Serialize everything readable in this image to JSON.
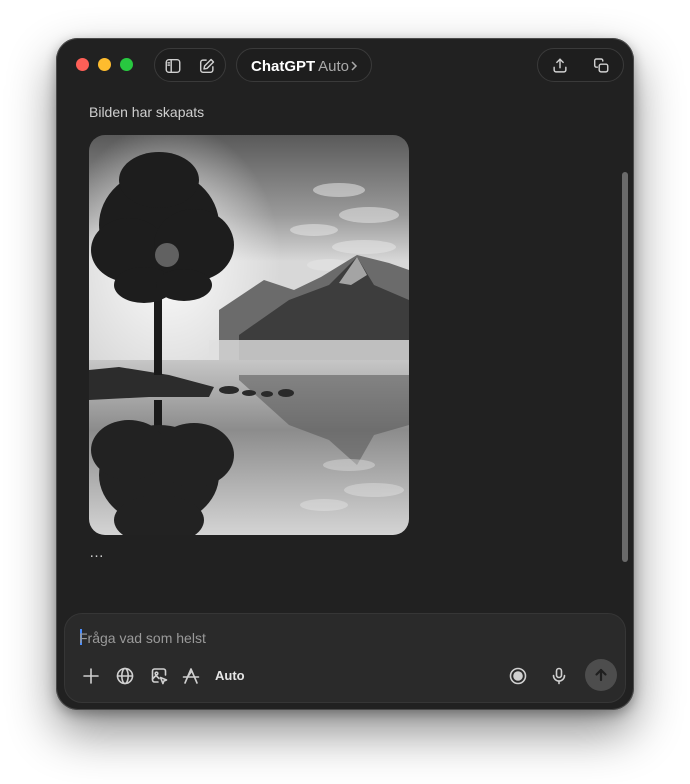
{
  "header": {
    "model_name": "ChatGPT",
    "model_mode": "Auto"
  },
  "conversation": {
    "status": "Bilden har skapats",
    "image": {
      "description_icon": "generated-image",
      "content": "black-and-white landscape"
    },
    "more_options": "…"
  },
  "composer": {
    "placeholder": "Fråga vad som helst",
    "mode_label": "Auto",
    "tools": [
      "plus-icon",
      "globe-icon",
      "image-edit-icon",
      "tools-icon"
    ],
    "right_tools": [
      "voice-mode-icon",
      "microphone-icon",
      "send-icon"
    ]
  },
  "colors": {
    "window_bg": "#212121",
    "composer_bg": "#2a2a2a",
    "traffic_red": "#fe5f57",
    "traffic_yellow": "#febc2e",
    "traffic_green": "#28c840",
    "caret": "#4b8dfc"
  }
}
